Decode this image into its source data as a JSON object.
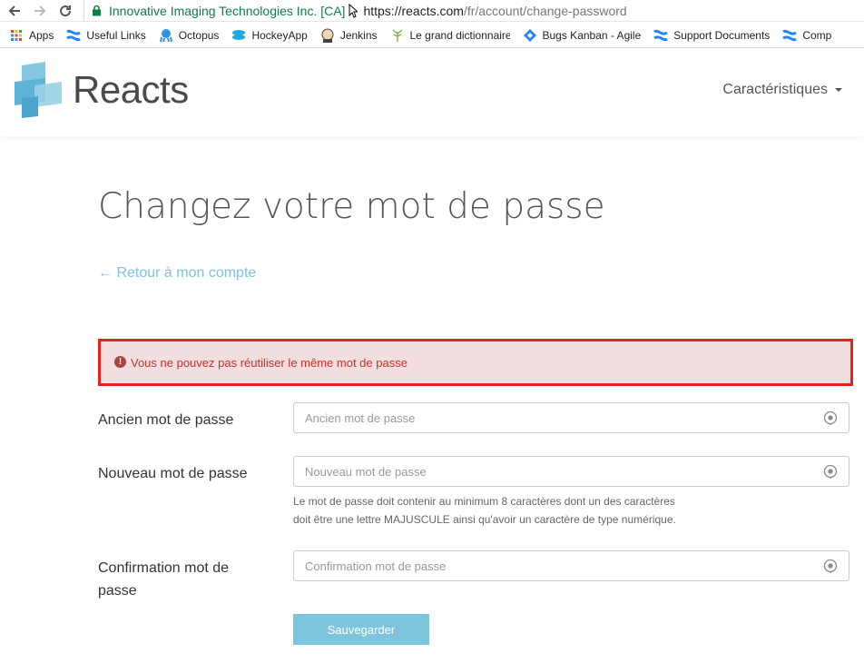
{
  "browser": {
    "org": "Innovative Imaging Technologies Inc. [CA]",
    "url_host": "https://reacts.com",
    "url_path": "/fr/account/change-password",
    "bookmarks": [
      {
        "label": "Apps",
        "icon": "apps-grid-icon"
      },
      {
        "label": "Useful Links",
        "icon": "confluence-icon"
      },
      {
        "label": "Octopus",
        "icon": "octopus-icon"
      },
      {
        "label": "HockeyApp",
        "icon": "hockeyapp-icon"
      },
      {
        "label": "Jenkins",
        "icon": "jenkins-icon"
      },
      {
        "label": "Le grand dictionnaire",
        "icon": "dictionary-icon"
      },
      {
        "label": "Bugs Kanban - Agile",
        "icon": "jira-icon"
      },
      {
        "label": "Support Documents",
        "icon": "confluence-icon"
      },
      {
        "label": "Comp",
        "icon": "confluence-icon"
      }
    ]
  },
  "header": {
    "logo_text": "Reacts",
    "nav_features": "Caractéristiques"
  },
  "main": {
    "title": "Changez votre mot de passe",
    "back_link": "← Retour à mon compte",
    "alert": "Vous ne pouvez pas réutiliser le même mot de passe",
    "old_password": {
      "label": "Ancien mot de passe",
      "placeholder": "Ancien mot de passe"
    },
    "new_password": {
      "label": "Nouveau mot de passe",
      "placeholder": "Nouveau mot de passe"
    },
    "help_line1": "Le mot de passe doit contenir au minimum 8 caractères dont un des caractères",
    "help_line2": "doit être une lettre MAJUSCULE ainsi qu'avoir un caractère de type numérique.",
    "confirm_password": {
      "label": "Confirmation mot de passe",
      "placeholder": "Confirmation mot de passe"
    },
    "save_label": "Sauvegarder"
  },
  "colors": {
    "accent": "#7cc5dd",
    "alert_bg": "#f2dede",
    "alert_border": "#e3241b",
    "alert_text": "#c9302c",
    "secure_org": "#0b8043"
  }
}
